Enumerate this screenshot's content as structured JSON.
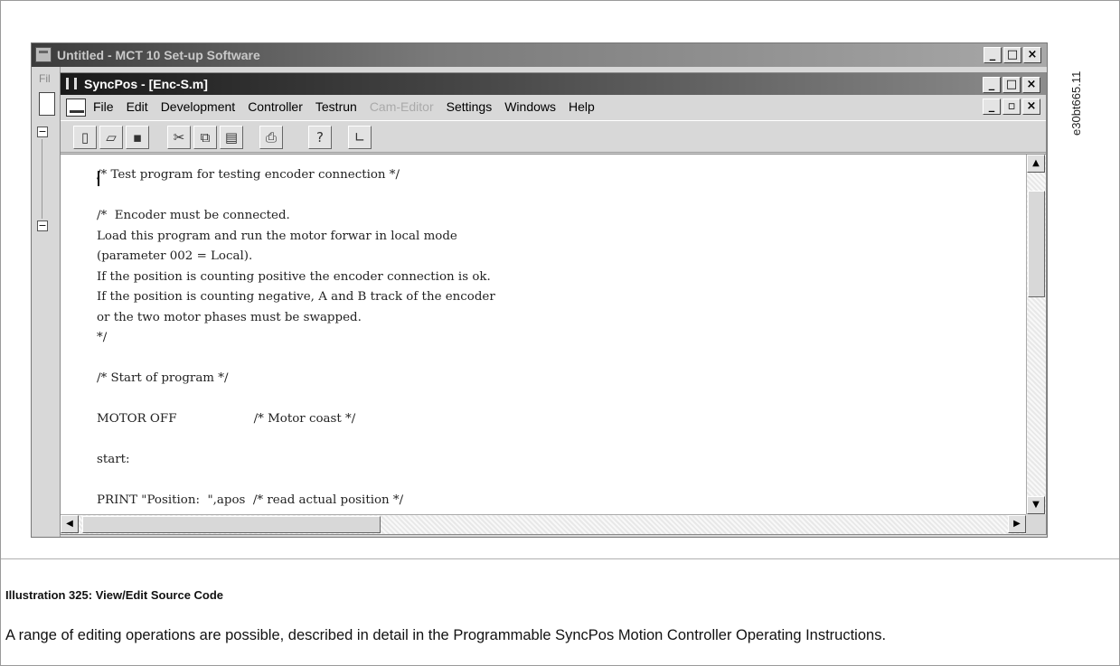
{
  "figure_id": "e30bt665.11",
  "outer_window": {
    "title": "Untitled - MCT 10 Set-up Software",
    "menu_fragment": "Fil",
    "buttons": [
      "_",
      "□",
      "×"
    ]
  },
  "inner_window": {
    "title": "SyncPos - [Enc-S.m]",
    "buttons": [
      "_",
      "□",
      "×"
    ],
    "mdi_buttons": [
      "_",
      "▫",
      "×"
    ]
  },
  "menu": {
    "items": [
      {
        "label": "File",
        "enabled": true
      },
      {
        "label": "Edit",
        "enabled": true
      },
      {
        "label": "Development",
        "enabled": true
      },
      {
        "label": "Controller",
        "enabled": true
      },
      {
        "label": "Testrun",
        "enabled": true
      },
      {
        "label": "Cam-Editor",
        "enabled": false
      },
      {
        "label": "Settings",
        "enabled": true
      },
      {
        "label": "Windows",
        "enabled": true
      },
      {
        "label": "Help",
        "enabled": true
      }
    ]
  },
  "toolbar": {
    "icons": [
      "new-file-icon",
      "open-folder-icon",
      "save-icon",
      "cut-icon",
      "copy-icon",
      "paste-icon",
      "print-icon",
      "help-icon",
      "chart-icon"
    ]
  },
  "editor": {
    "lines": [
      "/* Test program for testing encoder connection */",
      "",
      "/*  Encoder must be connected.",
      "Load this program and run the motor forwar in local mode",
      "(parameter 002 = Local).",
      "If the position is counting positive the encoder connection is ok.",
      "If the position is counting negative, A and B track of the encoder",
      "or the two motor phases must be swapped.",
      "*/",
      "",
      "/* Start of program */",
      "",
      "MOTOR OFF                    /* Motor coast */",
      "",
      "start:",
      "",
      "PRINT \"Position:  \",apos  /* read actual position */"
    ]
  },
  "caption": "Illustration 325: View/Edit Source Code",
  "description": "A range of editing operations are possible, described in detail in the Programmable SyncPos Motion Controller Operating Instructions."
}
